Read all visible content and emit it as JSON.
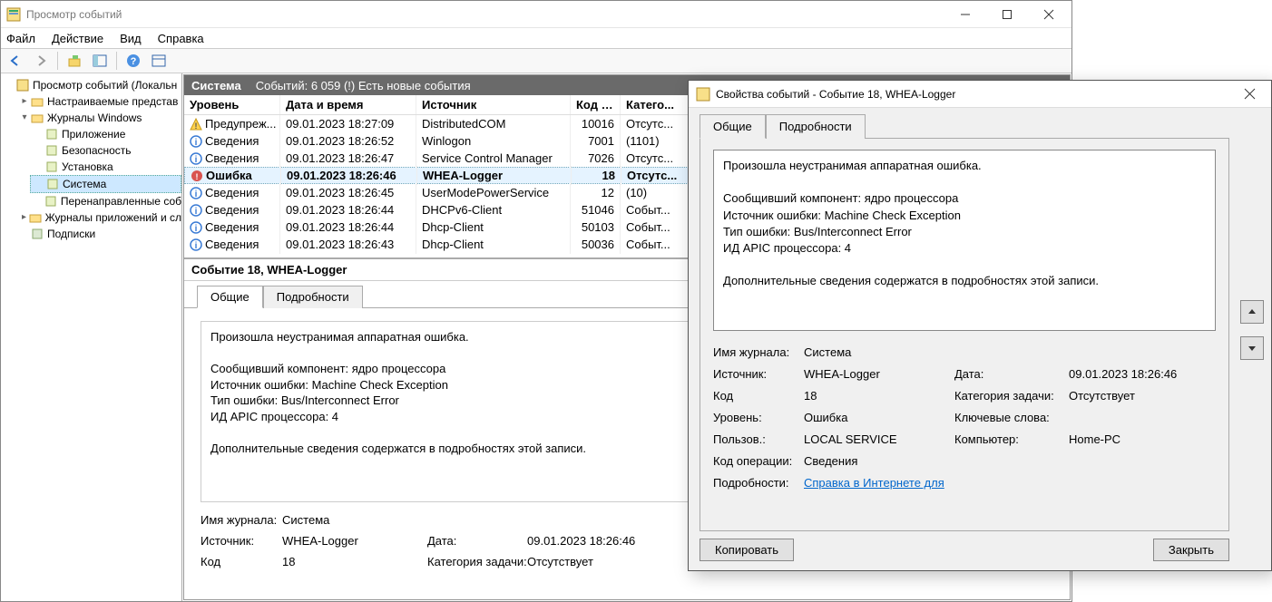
{
  "window": {
    "title": "Просмотр событий"
  },
  "menu": {
    "file": "Файл",
    "action": "Действие",
    "view": "Вид",
    "help": "Справка"
  },
  "tree": {
    "root": "Просмотр событий (Локальн",
    "custom": "Настраиваемые представ",
    "journals": "Журналы Windows",
    "app": "Приложение",
    "security": "Безопасность",
    "install": "Установка",
    "system": "Система",
    "forwarded": "Перенаправленные соб",
    "appsrv": "Журналы приложений и сл",
    "subs": "Подписки"
  },
  "content_header": {
    "title": "Система",
    "count": "Событий: 6 059 (!) Есть новые события"
  },
  "columns": {
    "level": "Уровень",
    "date": "Дата и время",
    "source": "Источник",
    "code": "Код со...",
    "cat": "Катего..."
  },
  "events": [
    {
      "level": "Предупреж...",
      "icon": "warn",
      "date": "09.01.2023 18:27:09",
      "src": "DistributedCOM",
      "code": "10016",
      "cat": "Отсутс..."
    },
    {
      "level": "Сведения",
      "icon": "info",
      "date": "09.01.2023 18:26:52",
      "src": "Winlogon",
      "code": "7001",
      "cat": "(1101)"
    },
    {
      "level": "Сведения",
      "icon": "info",
      "date": "09.01.2023 18:26:47",
      "src": "Service Control Manager",
      "code": "7026",
      "cat": "Отсутс..."
    },
    {
      "level": "Ошибка",
      "icon": "error",
      "date": "09.01.2023 18:26:46",
      "src": "WHEA-Logger",
      "code": "18",
      "cat": "Отсутс...",
      "selected": true
    },
    {
      "level": "Сведения",
      "icon": "info",
      "date": "09.01.2023 18:26:45",
      "src": "UserModePowerService",
      "code": "12",
      "cat": "(10)"
    },
    {
      "level": "Сведения",
      "icon": "info",
      "date": "09.01.2023 18:26:44",
      "src": "DHCPv6-Client",
      "code": "51046",
      "cat": "Событ..."
    },
    {
      "level": "Сведения",
      "icon": "info",
      "date": "09.01.2023 18:26:44",
      "src": "Dhcp-Client",
      "code": "50103",
      "cat": "Событ..."
    },
    {
      "level": "Сведения",
      "icon": "info",
      "date": "09.01.2023 18:26:43",
      "src": "Dhcp-Client",
      "code": "50036",
      "cat": "Событ..."
    }
  ],
  "detail": {
    "header": "Событие 18, WHEA-Logger",
    "tab_general": "Общие",
    "tab_details": "Подробности",
    "message": "Произошла неустранимая аппаратная ошибка.\n\nСообщивший компонент: ядро процессора\nИсточник ошибки: Machine Check Exception\nТип ошибки: Bus/Interconnect Error\nИД APIC процессора: 4\n\nДополнительные сведения содержатся в подробностях этой записи.",
    "labels": {
      "journal": "Имя журнала:",
      "source": "Источник:",
      "code": "Код",
      "task": "Категория задачи:",
      "level": "Уровень:",
      "keywords": "Ключевые слова:",
      "user": "Пользов.:",
      "computer": "Компьютер:",
      "opcode": "Код операции:",
      "moreinfo": "Подробности:",
      "date": "Дата:"
    },
    "values": {
      "journal": "Система",
      "source": "WHEA-Logger",
      "date": "09.01.2023 18:26:46",
      "code": "18",
      "task": "Отсутствует",
      "level": "Ошибка",
      "keywords": "",
      "user": "LOCAL SERVICE",
      "computer": "Home-PC",
      "opcode": "Сведения",
      "moreinfo_link": "Справка в Интернете для"
    }
  },
  "dialog": {
    "title": "Свойства событий - Событие 18, WHEA-Logger",
    "copy": "Копировать",
    "close": "Закрыть"
  }
}
